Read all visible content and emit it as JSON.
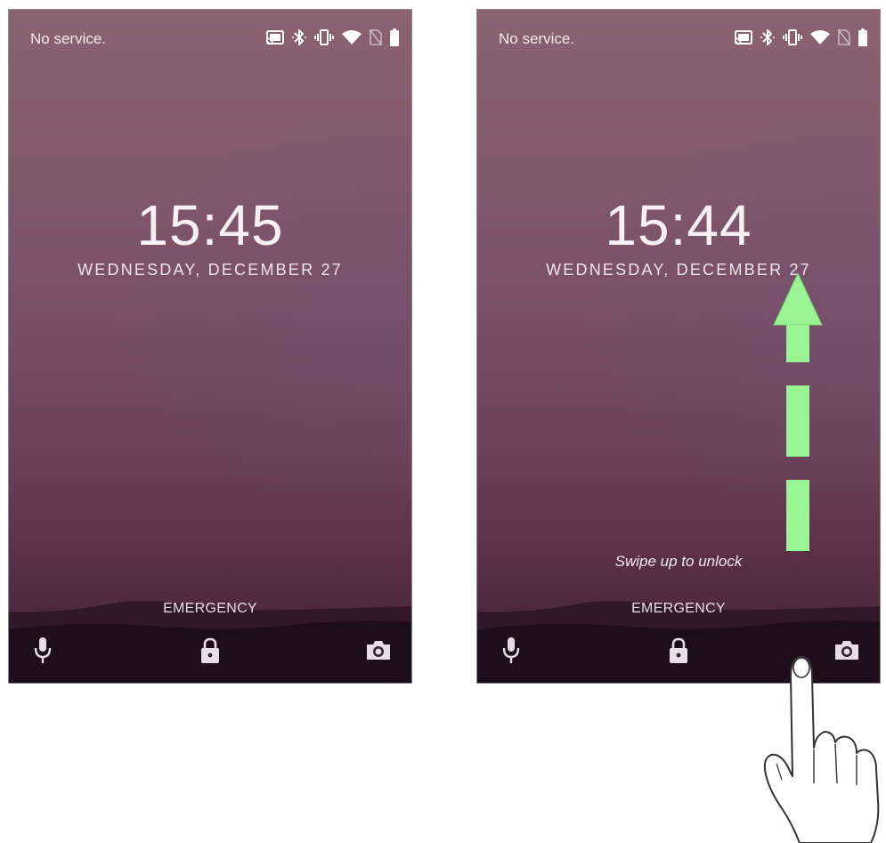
{
  "left_screen": {
    "carrier": "No service.",
    "time": "15:45",
    "date": "WEDNESDAY, DECEMBER 27",
    "emergency": "EMERGENCY"
  },
  "right_screen": {
    "carrier": "No service.",
    "time": "15:44",
    "date": "WEDNESDAY, DECEMBER 27",
    "hint": "Swipe up to unlock",
    "emergency": "EMERGENCY"
  },
  "status_icons": [
    "cast-icon",
    "bluetooth-icon",
    "vibrate-icon",
    "wifi-icon",
    "no-sim-icon",
    "battery-icon"
  ],
  "bottom_icons": [
    "mic-icon",
    "lock-icon",
    "camera-icon"
  ],
  "colors": {
    "wallpaper_top": "#8a6270",
    "wallpaper_bottom": "#3b1e33",
    "arrow": "#99f593",
    "text": "#f7f1f4"
  }
}
